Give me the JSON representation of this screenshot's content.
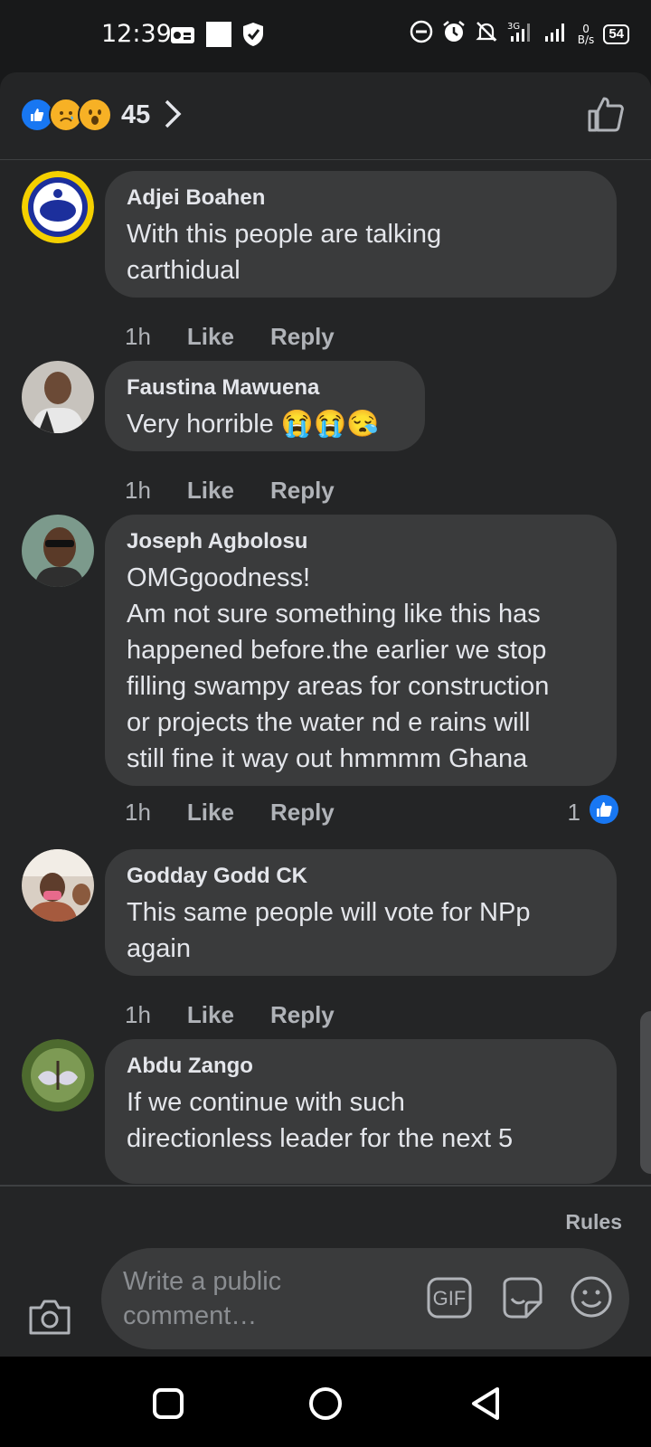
{
  "status_bar": {
    "time": "12:39",
    "net_speed_top": "0",
    "net_speed_bottom": "B/s",
    "battery": "54"
  },
  "reactions": {
    "count": "45",
    "types": [
      "like-icon",
      "sad-icon",
      "wow-icon"
    ]
  },
  "comments": [
    {
      "author": "Adjei Boahen",
      "text": "With this people are talking\ncarthidual",
      "time": "1h",
      "like": "Like",
      "reply": "Reply"
    },
    {
      "author": "Faustina Mawuena",
      "text": "Very horrible 😭😭😪",
      "time": "1h",
      "like": "Like",
      "reply": "Reply"
    },
    {
      "author": "Joseph Agbolosu",
      "text": "OMGgoodness!\nAm not sure something like this has\nhappened before.the earlier we stop\nfilling swampy areas for construction\nor projects the water nd e rains will\nstill fine it way out hmmmm Ghana",
      "time": "1h",
      "like": "Like",
      "reply": "Reply",
      "like_count": "1"
    },
    {
      "author": "Godday Godd CK",
      "text": "This same people will vote for NPp\nagain",
      "time": "1h",
      "like": "Like",
      "reply": "Reply"
    },
    {
      "author": "Abdu Zango",
      "text": "If we continue with such\ndirectionless leader for the next 5",
      "time": "",
      "like": "",
      "reply": ""
    }
  ],
  "composer": {
    "rules": "Rules",
    "placeholder": "Write a public comment…",
    "gif": "GIF"
  },
  "colors": {
    "background": "#18191a",
    "sheet": "#242526",
    "bubble": "#3a3b3c",
    "like_blue": "#1877f2",
    "secondary_text": "#b0b3b8"
  }
}
